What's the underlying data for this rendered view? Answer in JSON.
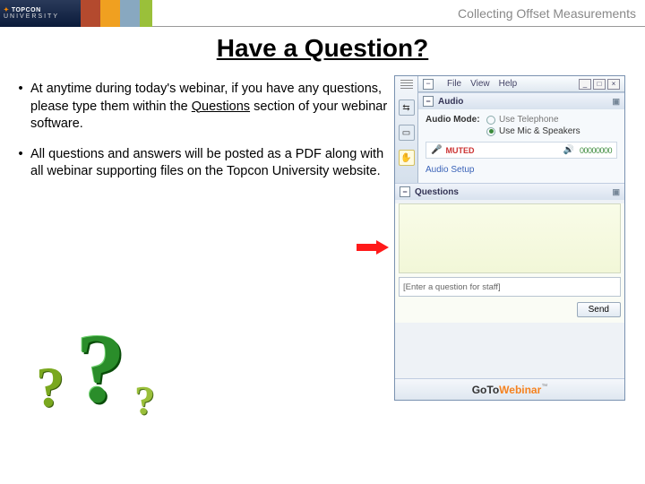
{
  "header": {
    "logo_brand": "TOPCON",
    "logo_sub": "UNIVERSITY",
    "right_text": "Collecting Offset Measurements"
  },
  "title": "Have a Question?",
  "bullets": [
    {
      "pre": "At anytime during today's webinar, if you have any questions, please type them within the ",
      "u": "Questions",
      "post": " section of your webinar software."
    },
    {
      "pre": "All questions and answers will be posted as a PDF along with all webinar supporting files on the Topcon University website.",
      "u": "",
      "post": ""
    }
  ],
  "panel": {
    "menu": {
      "file": "File",
      "view": "View",
      "help": "Help"
    },
    "window_buttons": {
      "min": "_",
      "max": "□",
      "close": "×"
    },
    "toggle_glyph": "−",
    "audio": {
      "title": "Audio",
      "mode_label": "Audio Mode:",
      "opt_tel": "Use Telephone",
      "opt_mic": "Use Mic & Speakers",
      "muted": "MUTED",
      "levels": "00000000",
      "setup": "Audio Setup"
    },
    "questions": {
      "title": "Questions",
      "placeholder": "[Enter a question for staff]",
      "send": "Send"
    },
    "footer": {
      "goto": "GoTo",
      "webinar": "Webinar",
      "tm": "™"
    }
  }
}
